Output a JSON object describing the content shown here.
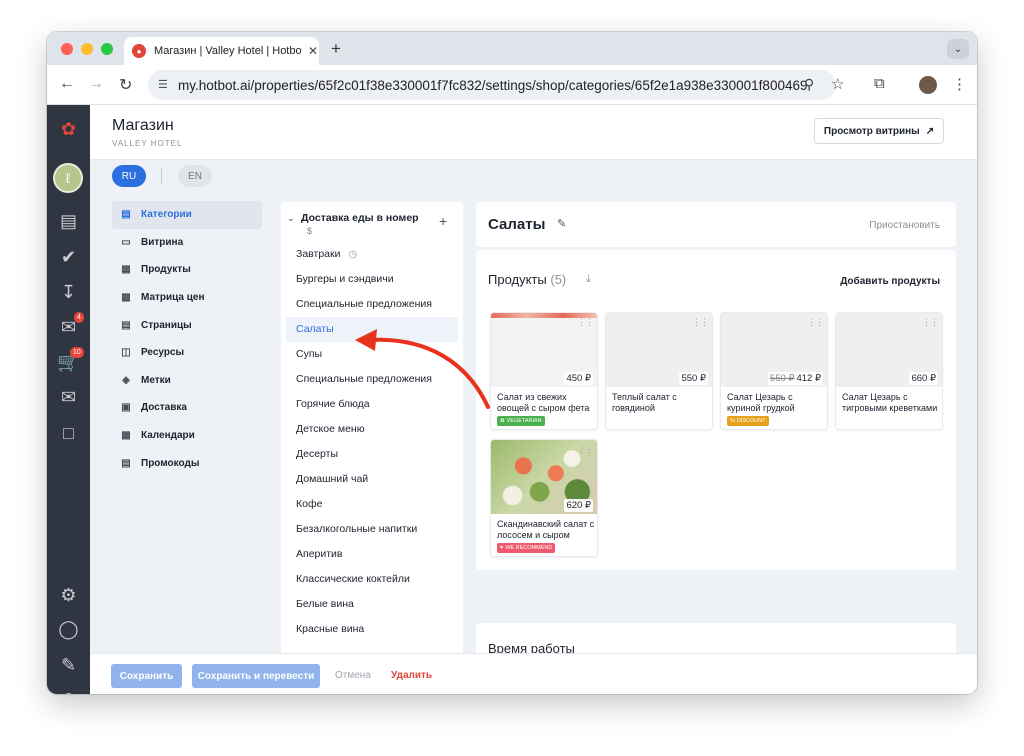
{
  "browser": {
    "tab_title": "Магазин | Valley Hotel | Hotbot",
    "url": "my.hotbot.ai/properties/65f2c01f38e330001f7fc832/settings/shop/categories/65f2e1a938e330001f800469"
  },
  "sidebar": {
    "badges": {
      "inbox": "4",
      "cart": "10"
    }
  },
  "header": {
    "title": "Магазин",
    "subtitle": "VALLEY HOTEL",
    "store_button": "Просмотр витрины"
  },
  "languages": {
    "ru": "RU",
    "en": "EN"
  },
  "settings_nav": [
    {
      "label": "Категории",
      "icon": "store-icon"
    },
    {
      "label": "Витрина",
      "icon": "showcase-icon"
    },
    {
      "label": "Продукты",
      "icon": "products-icon"
    },
    {
      "label": "Матрица цен",
      "icon": "price-matrix-icon"
    },
    {
      "label": "Страницы",
      "icon": "pages-icon"
    },
    {
      "label": "Ресурсы",
      "icon": "resources-icon"
    },
    {
      "label": "Метки",
      "icon": "tags-icon"
    },
    {
      "label": "Доставка",
      "icon": "delivery-icon"
    },
    {
      "label": "Календари",
      "icon": "calendar-icon"
    },
    {
      "label": "Промокоды",
      "icon": "promocodes-icon"
    }
  ],
  "categories": {
    "group_title": "Доставка еды в номер",
    "group_currency": "$",
    "items": [
      "Завтраки",
      "Бургеры и сэндвичи",
      "Специальные предложения",
      "Салаты",
      "Супы",
      "Специальные предложения",
      "Горячие блюда",
      "Детское меню",
      "Десерты",
      "Домашний чай",
      "Кофе",
      "Безалкогольные напитки",
      "Аперитив",
      "Классические коктейли",
      "Белые вина",
      "Красные вина"
    ]
  },
  "category": {
    "title": "Салаты",
    "pause_label": "Приостановить"
  },
  "products": {
    "title": "Продукты",
    "count": "(5)",
    "add_label": "Добавить продукты",
    "items": [
      {
        "name": "Салат из свежих овощей с сыром фета",
        "price": "450 ₽",
        "old_price": "",
        "tag": "VEGETARIAN"
      },
      {
        "name": "Теплый салат с говядиной",
        "price": "550 ₽",
        "old_price": "",
        "tag": ""
      },
      {
        "name": "Салат Цезарь с куриной грудкой",
        "price": "412 ₽",
        "old_price": "550 ₽",
        "tag": "DISCOUNT"
      },
      {
        "name": "Салат Цезарь с тигровыми креветками",
        "price": "660 ₽",
        "old_price": "",
        "tag": ""
      },
      {
        "name": "Скандинавский салат с лососем и сыром",
        "price": "620 ₽",
        "old_price": "",
        "tag": "WE RECOMMEND"
      }
    ]
  },
  "hours": {
    "title": "Время работы"
  },
  "footer": {
    "save": "Сохранить",
    "save_translate": "Сохранить и перевести",
    "cancel": "Отмена",
    "delete": "Удалить"
  },
  "colors": {
    "accent": "#2b6fe0",
    "danger": "#e0453a",
    "sidebar": "#2f3541",
    "arrow": "#e8321e"
  }
}
